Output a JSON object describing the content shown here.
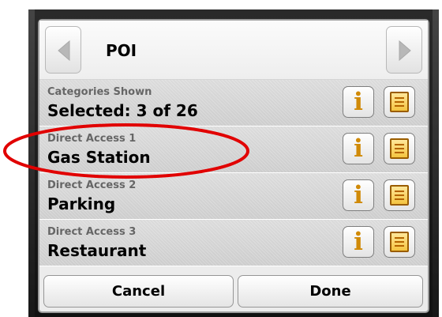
{
  "header": {
    "title": "POI"
  },
  "rows": [
    {
      "label": "Categories Shown",
      "value": "Selected: 3 of 26"
    },
    {
      "label": "Direct Access 1",
      "value": "Gas Station"
    },
    {
      "label": "Direct Access 2",
      "value": "Parking"
    },
    {
      "label": "Direct Access 3",
      "value": "Restaurant"
    }
  ],
  "buttons": {
    "cancel": "Cancel",
    "done": "Done",
    "info_symbol": "i"
  },
  "icons": {
    "back": "chevron-left-icon",
    "forward": "chevron-right-icon",
    "info": "info-icon",
    "list": "list-icon"
  },
  "colors": {
    "highlight": "#e10000",
    "info_icon": "#d08a08",
    "list_icon": "#f4c440"
  }
}
